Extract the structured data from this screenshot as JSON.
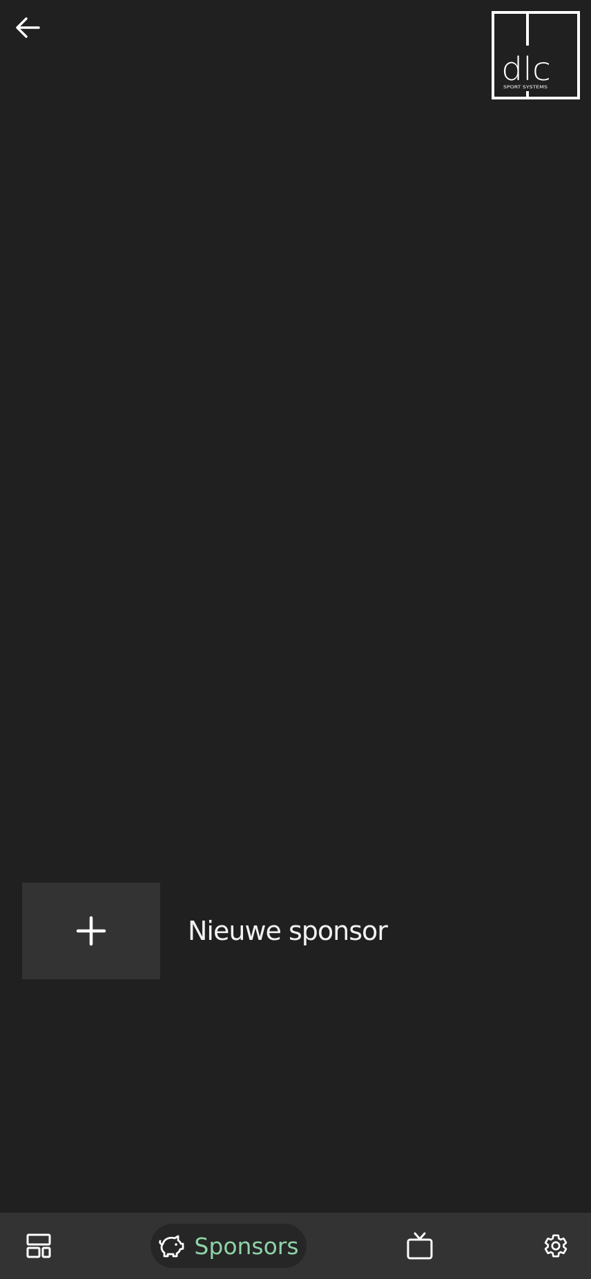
{
  "header": {
    "back_icon": "arrow-left-icon",
    "logo": {
      "name": "dlc",
      "tagline": "SPORT SYSTEMS"
    }
  },
  "main": {
    "new_sponsor": {
      "icon": "plus-icon",
      "label": "Nieuwe sponsor"
    }
  },
  "bottom_nav": {
    "items": [
      {
        "icon": "dashboard-layout-icon",
        "label": "",
        "active": false
      },
      {
        "icon": "piggy-bank-icon",
        "label": "Sponsors",
        "active": true
      },
      {
        "icon": "tv-icon",
        "label": "",
        "active": false
      },
      {
        "icon": "gear-icon",
        "label": "",
        "active": false
      }
    ]
  },
  "colors": {
    "background": "#202020",
    "surface": "#333333",
    "active_pill": "#262626",
    "accent": "#8fd3a8",
    "text": "#ffffff"
  }
}
